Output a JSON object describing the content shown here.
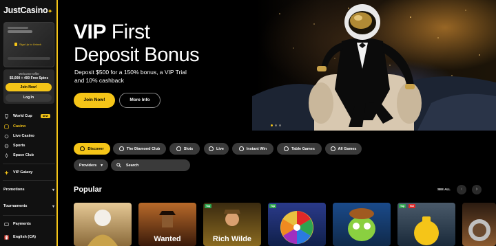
{
  "sidebar": {
    "logo": "JustCasino",
    "vip_card": {
      "signup": "Sign Up to Unlock"
    },
    "welcome": {
      "label": "Welcome Offer",
      "offer": "$5,000 + 400 Free Spins"
    },
    "join_label": "Join Now!",
    "login_label": "Log In",
    "nav": [
      {
        "label": "World Cup",
        "badge": "NEW",
        "icon": "trophy-icon"
      },
      {
        "label": "Casino",
        "icon": "cherry-icon",
        "active": true
      },
      {
        "label": "Live Casino",
        "icon": "live-icon"
      },
      {
        "label": "Sports",
        "icon": "ball-icon"
      },
      {
        "label": "Space Club",
        "icon": "rocket-icon"
      }
    ],
    "vip_galaxy": "VIP Galaxy",
    "promotions": "Promotions",
    "tournaments": "Tournaments",
    "payments": "Payments",
    "language": "English (CA)"
  },
  "hero": {
    "title_bold": "VIP",
    "title_rest": " First",
    "title_line2": "Deposit Bonus",
    "subtitle": "Deposit $500 for a 150% bonus, a VIP Trial and 10% cashback",
    "join_label": "Join Now!",
    "more_label": "More Info"
  },
  "filters": {
    "chips": [
      {
        "label": "Discover",
        "active": true,
        "icon": "discover-icon"
      },
      {
        "label": "The Diamond Club",
        "icon": "diamond-icon"
      },
      {
        "label": "Slots",
        "icon": "slots-icon"
      },
      {
        "label": "Live",
        "icon": "live-icon"
      },
      {
        "label": "Instant Win",
        "icon": "instant-icon"
      },
      {
        "label": "Table Games",
        "icon": "table-icon"
      },
      {
        "label": "All Games",
        "icon": "grid-icon"
      }
    ],
    "providers_label": "Providers",
    "search_placeholder": "Search"
  },
  "popular": {
    "heading": "Popular",
    "see_all": "SEE ALL",
    "tiles": [
      {
        "title": "",
        "badges": []
      },
      {
        "title": "Wanted",
        "badges": []
      },
      {
        "title": "Rich Wilde",
        "badges": [
          "Top"
        ]
      },
      {
        "title": "",
        "badges": [
          "Top"
        ]
      },
      {
        "title": "",
        "badges": []
      },
      {
        "title": "",
        "badges": [
          "Top",
          "Hot"
        ]
      },
      {
        "title": "",
        "badges": []
      }
    ]
  },
  "colors": {
    "accent": "#f5c518",
    "chip_bg": "#3a3a3a",
    "badge_top": "#2ea44f",
    "badge_hot": "#e02828"
  }
}
